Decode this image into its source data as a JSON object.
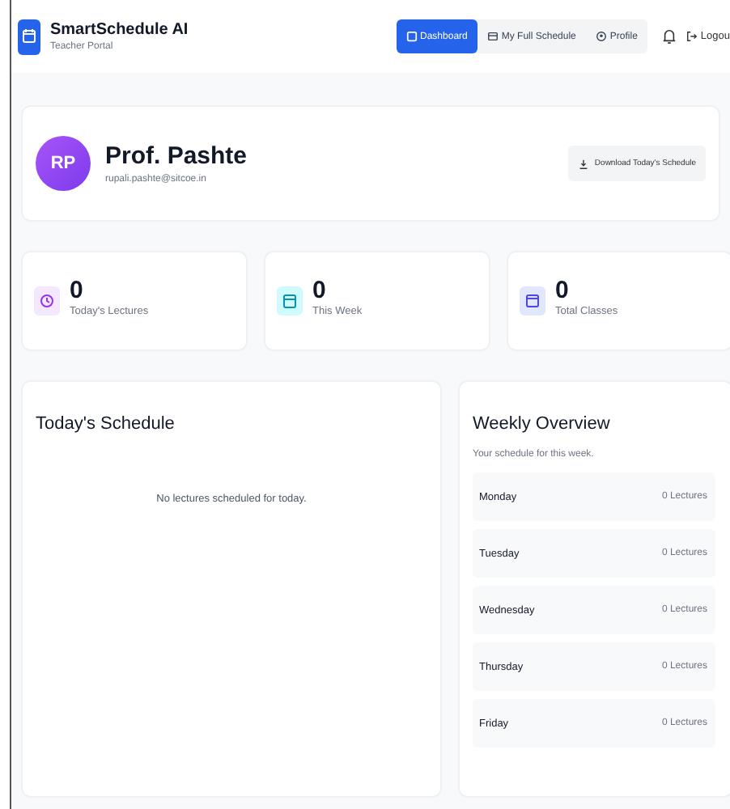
{
  "header": {
    "title": "SmartSchedule AI",
    "subtitle": "Teacher Portal",
    "nav": [
      {
        "label": "Dashboard",
        "selected": true
      },
      {
        "label": "My Full Schedule",
        "selected": false
      },
      {
        "label": "Profile",
        "selected": false
      }
    ],
    "logout": "Logou"
  },
  "profile": {
    "initials": "RP",
    "name": "Prof. Pashte",
    "email": "rupali.pashte@sitcoe.in",
    "download_button": "Download Today's Schedule"
  },
  "stats": [
    {
      "value": "0",
      "label": "Today's Lectures",
      "color": "#f3e8ff"
    },
    {
      "value": "0",
      "label": "This Week",
      "color": "#cffafe"
    },
    {
      "value": "0",
      "label": "Total Classes",
      "color": "#e0e7ff"
    }
  ],
  "today": {
    "title": "Today's Schedule",
    "empty_message": "No lectures scheduled for today."
  },
  "weekly": {
    "title": "Weekly Overview",
    "subtitle": "Your schedule for this week.",
    "days": [
      {
        "day": "Monday",
        "count": "0 Lectures"
      },
      {
        "day": "Tuesday",
        "count": "0 Lectures"
      },
      {
        "day": "Wednesday",
        "count": "0 Lectures"
      },
      {
        "day": "Thursday",
        "count": "0 Lectures"
      },
      {
        "day": "Friday",
        "count": "0 Lectures"
      }
    ]
  }
}
